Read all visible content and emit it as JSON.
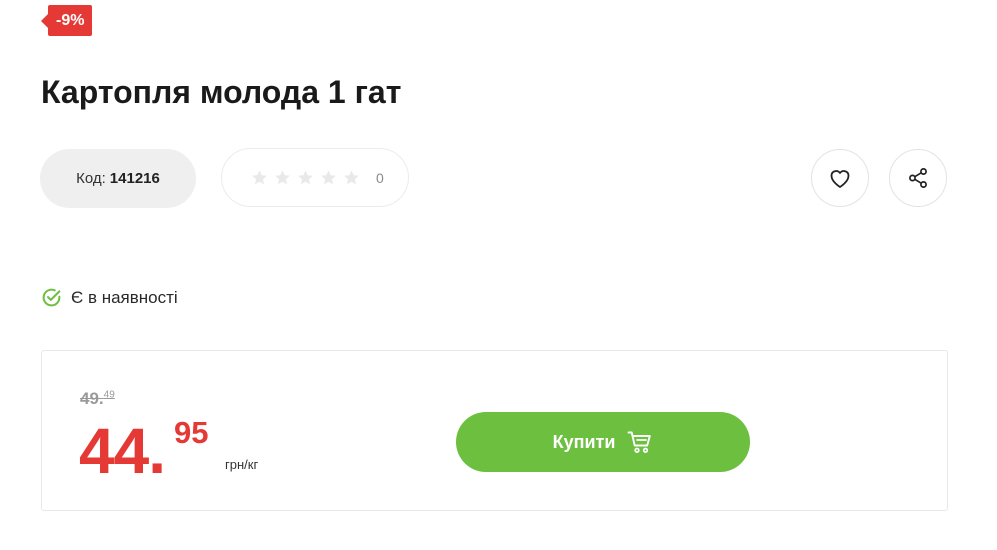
{
  "badge": {
    "discount": "-9%"
  },
  "product": {
    "title": "Картопля молода 1 гат"
  },
  "code": {
    "label": "Код:",
    "value": "141216"
  },
  "rating": {
    "stars_filled": 0,
    "stars_total": 5,
    "count": "0"
  },
  "availability": {
    "text": "Є в наявності",
    "color": "#6cbf3f"
  },
  "price": {
    "old_main": "49.",
    "old_cents": "49",
    "new_main": "44.",
    "new_cents": "95",
    "unit": "грн/кг"
  },
  "buy": {
    "label": "Купити",
    "icon": "cart-icon"
  },
  "actions": {
    "favorite_icon": "heart-icon",
    "share_icon": "share-icon"
  },
  "colors": {
    "accent_red": "#e53935",
    "accent_green": "#6cbf3f"
  }
}
